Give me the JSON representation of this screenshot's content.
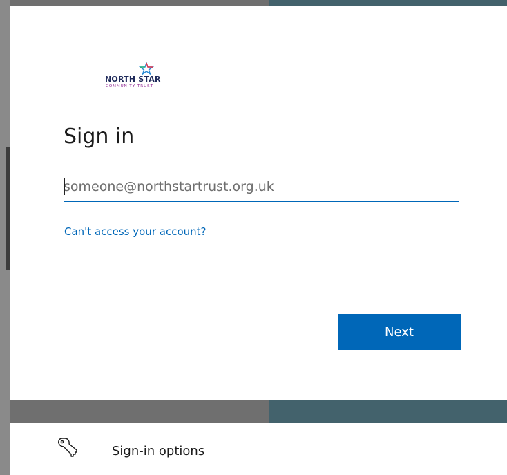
{
  "brand": {
    "name": "NORTH STAR",
    "tagline": "COMMUNITY TRUST"
  },
  "signin": {
    "title": "Sign in",
    "email_placeholder": "someone@northstartrust.org.uk",
    "email_value": "",
    "cant_access_link": "Can't access your account?",
    "next_label": "Next"
  },
  "options": {
    "label": "Sign-in options",
    "icon": "key-icon"
  },
  "colors": {
    "accent": "#0067b8",
    "brand_navy": "#1f2a5a",
    "brand_purple": "#8a1e8e",
    "background_teal": "#43626c",
    "background_gray": "#6f6f6f"
  }
}
